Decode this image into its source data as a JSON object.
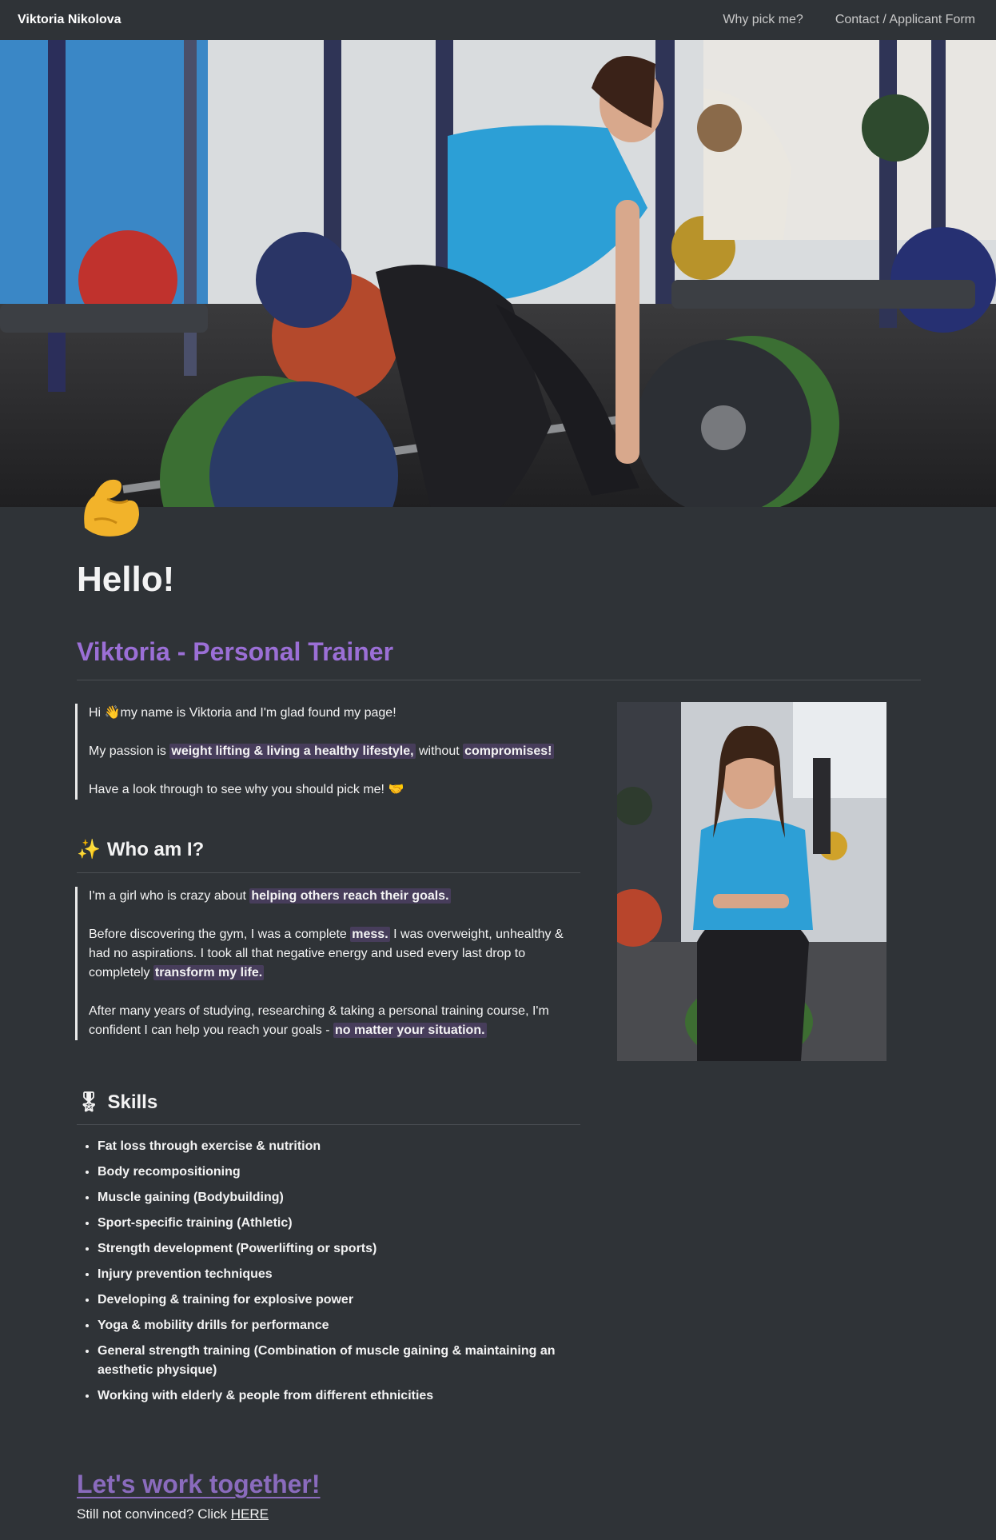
{
  "nav": {
    "brand": "Viktoria Nikolova",
    "links": [
      "Why pick me?",
      "Contact / Applicant Form"
    ]
  },
  "hero": {
    "image": "woman-deadlifting-barbell-in-gym-photo"
  },
  "header_icon": "flexed-biceps-emoji",
  "hello": "Hello!",
  "subtitle": "Viktoria - Personal Trainer",
  "intro": {
    "p1": {
      "pre": "Hi ",
      "wave": "👋",
      "post": "my name is Viktoria and I'm glad found my page!"
    },
    "p2": {
      "pre": "My passion is ",
      "hl1": "weight lifting & living a healthy lifestyle,",
      "mid": " without ",
      "hl2": "compromises!"
    },
    "p3": {
      "text": "Have a look through to see why you should pick me! ",
      "emoji": "🤝"
    }
  },
  "who": {
    "heading_icon": "✨",
    "heading": "Who am I?",
    "p1": {
      "pre": "I'm a girl who is crazy about ",
      "hl": "helping others reach their goals."
    },
    "p2": {
      "pre": "Before discovering the gym, I was a complete ",
      "hl1": "mess.",
      "mid": " I was overweight, unhealthy & had no aspirations. I took all that negative energy and used every last drop to completely ",
      "hl2": "transform my life."
    },
    "p3": {
      "pre": "After many years of studying, researching & taking a personal training course, I'm confident I can help you reach your goals - ",
      "hl": "no matter your situation."
    }
  },
  "portrait": {
    "image": "woman-sitting-on-weight-plates-photo"
  },
  "skills": {
    "heading_icon": "🎖",
    "heading": "Skills",
    "items": [
      "Fat loss through exercise & nutrition",
      "Body recompositioning",
      "Muscle gaining (Bodybuilding)",
      "Sport-specific training (Athletic)",
      "Strength development (Powerlifting or sports)",
      "Injury prevention techniques",
      "Developing & training for explosive power",
      "Yoga & mobility drills for performance",
      "General strength training (Combination of muscle gaining & maintaining an aesthetic physique)",
      "Working with elderly & people from different ethnicities"
    ]
  },
  "cta": {
    "heading": "Let's work together!",
    "pre": "Still not convinced? Click ",
    "link": "HERE"
  }
}
